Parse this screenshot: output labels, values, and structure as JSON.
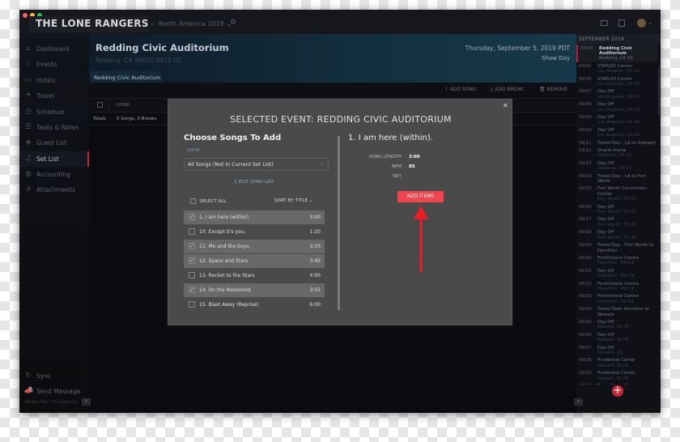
{
  "window": {
    "logo": "THE LONE RANGERS",
    "tour": "North America 2019",
    "traffic_colors": [
      "#fc5f57",
      "#fdbc2e",
      "#28c840"
    ]
  },
  "sidebar": {
    "items": [
      {
        "label": "Dashboard",
        "icon": "home-icon",
        "glyph": "⌂"
      },
      {
        "label": "Events",
        "icon": "star-icon",
        "glyph": "☆"
      },
      {
        "label": "Hotels",
        "icon": "hotel-icon",
        "glyph": "▭"
      },
      {
        "label": "Travel",
        "icon": "plane-icon",
        "glyph": "✈"
      },
      {
        "label": "Schedule",
        "icon": "clock-icon",
        "glyph": "◷"
      },
      {
        "label": "Tasks & Notes",
        "icon": "list-icon",
        "glyph": "☰"
      },
      {
        "label": "Guest List",
        "icon": "ticket-icon",
        "glyph": "◈"
      },
      {
        "label": "Set List",
        "icon": "music-icon",
        "glyph": "♫",
        "selected": true
      },
      {
        "label": "Accounting",
        "icon": "piggy-bank-icon",
        "glyph": "◍"
      },
      {
        "label": "Attachments",
        "icon": "paperclip-icon",
        "glyph": "∂"
      }
    ],
    "sync": "Sync",
    "send_message": "Send Message",
    "version": "Master Tour 3.0.0-beta.11",
    "collapse": "«"
  },
  "header": {
    "venue": "Redding Civic Auditorium",
    "address": "Redding, CA 96001-0919 US",
    "date": "Thursday, September 5, 2019 PDT",
    "day_type": "Show Day",
    "tab": "Redding Civic Auditorium"
  },
  "toolbar": {
    "add_song": "ADD SONG",
    "add_break": "ADD BREAK",
    "remove": "REMOVE"
  },
  "table": {
    "col_song": "SONG",
    "totals_label": "Totals",
    "totals_value": "0 Songs, 0 Breaks"
  },
  "events_panel": {
    "month": "SEPTEMBER 2019",
    "more": "···",
    "collapse": "»",
    "items": [
      {
        "date": "09/05",
        "title": "Redding Civic Auditorium",
        "sub": "Redding, CA US",
        "selected": true
      },
      {
        "date": "09/05",
        "title": "STAPLES Center",
        "sub": "Los Angeles, CA US"
      },
      {
        "date": "09/06",
        "title": "STAPLES Center",
        "sub": "Los Angeles, CA US"
      },
      {
        "date": "09/07",
        "title": "Day Off",
        "sub": "Los Angeles, CA US"
      },
      {
        "date": "09/08",
        "title": "Day Off",
        "sub": "Los Angeles, CA US"
      },
      {
        "date": "09/09",
        "title": "Day Off",
        "sub": "Los Angeles, CA US"
      },
      {
        "date": "09/10",
        "title": "Day Off",
        "sub": "Los Angeles, CA US"
      },
      {
        "date": "09/11",
        "title": "Travel Day - LA to Oakland",
        "sub": ""
      },
      {
        "date": "09/12",
        "title": "Oracle Arena",
        "sub": "Oakland, CA US"
      },
      {
        "date": "09/13",
        "title": "Day Off",
        "sub": "Oakland, CA US"
      },
      {
        "date": "09/14",
        "title": "Travel Day - LA to Fort Worth",
        "sub": ""
      },
      {
        "date": "09/15",
        "title": "Fort Worth Convention Center",
        "sub": "Fort Worth, TX US"
      },
      {
        "date": "09/16",
        "title": "Day Off",
        "sub": "Fort Worth, TX US"
      },
      {
        "date": "09/17",
        "title": "Day Off",
        "sub": "Fort Worth, TX US"
      },
      {
        "date": "09/18",
        "title": "Day Off",
        "sub": "Fort Worth, TX US"
      },
      {
        "date": "09/19",
        "title": "Travel Day - Fort Worth to Hamilton",
        "sub": ""
      },
      {
        "date": "09/20",
        "title": "FirstOntario Centre",
        "sub": "Hamilton, ON CA"
      },
      {
        "date": "09/21",
        "title": "Day Off",
        "sub": "Hamilton, ON CA"
      },
      {
        "date": "09/22",
        "title": "FirstOntario Centre",
        "sub": "Hamilton, ON CA"
      },
      {
        "date": "09/23",
        "title": "FirstOntario Centre",
        "sub": "Hamilton, ON CA"
      },
      {
        "date": "09/24",
        "title": "Travel Date Hamilton to Newark",
        "sub": ""
      },
      {
        "date": "09/25",
        "title": "Day Off",
        "sub": "Newark, NJ US"
      },
      {
        "date": "09/26",
        "title": "Day Off",
        "sub": "Newark, NJ US"
      },
      {
        "date": "09/27",
        "title": "Day Off",
        "sub": "Newark, US"
      },
      {
        "date": "09/28",
        "title": "Prudential Center",
        "sub": "Newark, NJ US"
      },
      {
        "date": "09/29",
        "title": "Prudential Center",
        "sub": "Newark, NJ US"
      },
      {
        "date": "09/30",
        "title": "Travel Day - Newark to",
        "sub": ""
      }
    ]
  },
  "modal": {
    "title": "SELECTED EVENT: REDDING CIVIC AUDITORIUM",
    "choose": "Choose Songs To Add",
    "show_label": "SHOW",
    "show_value": "All Songs (Not In Current Set List)",
    "edit_song_list": "EDIT SONG LIST",
    "select_all": "SELECT ALL",
    "sort_by": "SORT BY: TITLE",
    "songs": [
      {
        "title": "1. I am here (within).",
        "duration": "3:00",
        "checked": true
      },
      {
        "title": "10. Except it's you.",
        "duration": "1:20",
        "checked": false
      },
      {
        "title": "11. Me and the boys.",
        "duration": "3:33",
        "checked": true
      },
      {
        "title": "12. Space and Stars",
        "duration": "3:45",
        "checked": true
      },
      {
        "title": "13. Rocket to the Stars",
        "duration": "4:00",
        "checked": false
      },
      {
        "title": "14. On the Meteoroid",
        "duration": "3:55",
        "checked": true
      },
      {
        "title": "15. Blast Away (Reprise)",
        "duration": "6:00",
        "checked": false
      }
    ],
    "detail": {
      "title": "1. I am here (within).",
      "song_length_label": "SONG LENGTH",
      "song_length": "3:00",
      "bpm_label": "BPM",
      "bpm": "85",
      "key_label": "KEY",
      "key": ""
    },
    "add_items": "ADD ITEMS",
    "accent": "#f0444e"
  }
}
